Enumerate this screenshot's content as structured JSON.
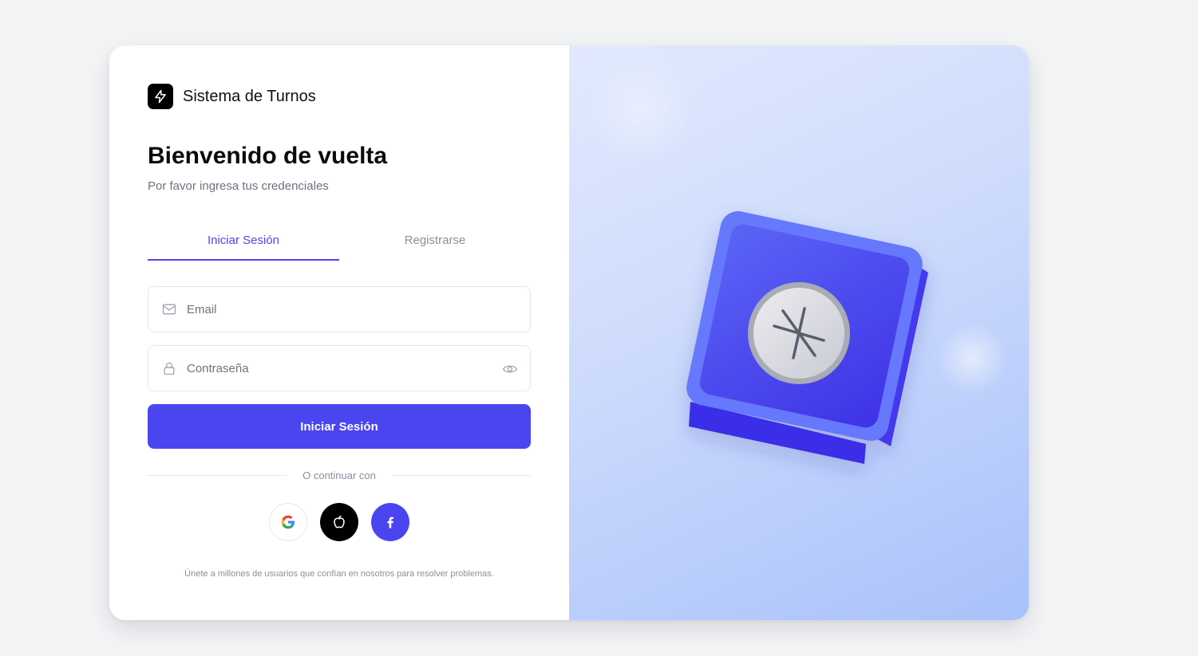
{
  "brand": {
    "name": "Sistema de Turnos",
    "logo_icon": "lightning-bolt-icon"
  },
  "heading": {
    "title": "Bienvenido de vuelta",
    "subtitle": "Por favor ingresa tus credenciales"
  },
  "tabs": [
    {
      "label": "Iniciar Sesión",
      "active": true
    },
    {
      "label": "Registrarse",
      "active": false
    }
  ],
  "form": {
    "email": {
      "placeholder": "Email",
      "value": "",
      "icon": "mail-icon"
    },
    "password": {
      "placeholder": "Contraseña",
      "value": "",
      "icon": "lock-icon",
      "toggle_icon": "eye-icon"
    },
    "submit_label": "Iniciar Sesión"
  },
  "divider_text": "O continuar con",
  "social": [
    {
      "name": "google",
      "icon": "google-icon"
    },
    {
      "name": "apple",
      "icon": "apple-icon"
    },
    {
      "name": "facebook",
      "icon": "facebook-icon"
    }
  ],
  "footnote": "Únete a millones de usuarios que confían en nosotros para resolver problemas.",
  "colors": {
    "accent": "#4b45f0",
    "page_bg": "#f3f4f6",
    "illustration_bg": "#c7d6fc"
  }
}
